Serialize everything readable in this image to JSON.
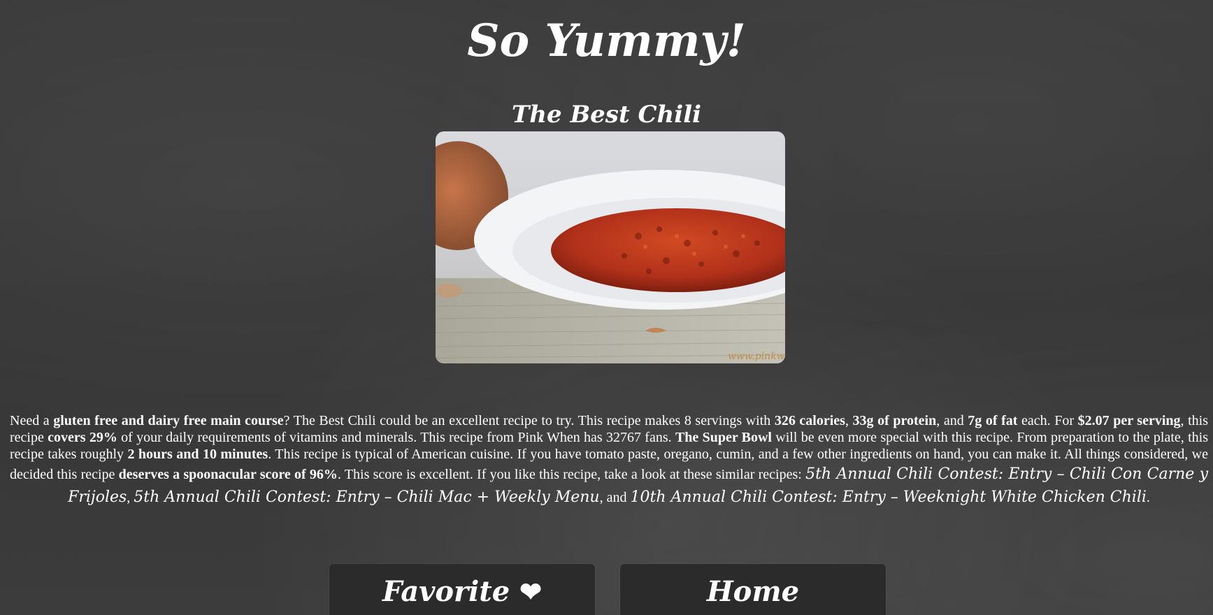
{
  "header": {
    "site_title": "So Yummy!"
  },
  "recipe": {
    "title": "The Best Chili",
    "image_watermark": "www.pinkwhen.com",
    "summary": {
      "s1": "Need a ",
      "b1": "gluten free and dairy free main course",
      "s2": "? The Best Chili could be an excellent recipe to try. This recipe makes 8 servings with ",
      "b2": "326 calories",
      "s3": ", ",
      "b3": "33g of protein",
      "s4": ", and ",
      "b4": "7g of fat",
      "s5": " each. For ",
      "b5": "$2.07 per serving",
      "s6": ", this recipe ",
      "b6": "covers 29%",
      "s7": " of your daily requirements of vitamins and minerals. This recipe from Pink When has 32767 fans. ",
      "b7": "The Super Bowl",
      "s8": " will be even more special with this recipe. From preparation to the plate, this recipe takes roughly ",
      "b8": "2 hours and 10 minutes",
      "s9": ". This recipe is typical of American cuisine. If you have tomato paste, oregano, cumin, and a few other ingredients on hand, you can make it. All things considered, we decided this recipe ",
      "b9": "deserves a spoonacular score of 96%",
      "s10": ". This score is excellent. If you like this recipe, take a look at these similar recipes: ",
      "link1": "5th Annual Chili Contest: Entry – Chili Con Carne y Frijoles",
      "s11": ", ",
      "link2": "5th Annual Chili Contest: Entry – Chili Mac + Weekly Menu",
      "s12": ", and ",
      "link3": "10th Annual Chili Contest: Entry – Weeknight White Chicken Chili",
      "s13": "."
    }
  },
  "buttons": {
    "favorite_label": "Favorite ",
    "favorite_icon": "❤",
    "home_label": "Home"
  }
}
